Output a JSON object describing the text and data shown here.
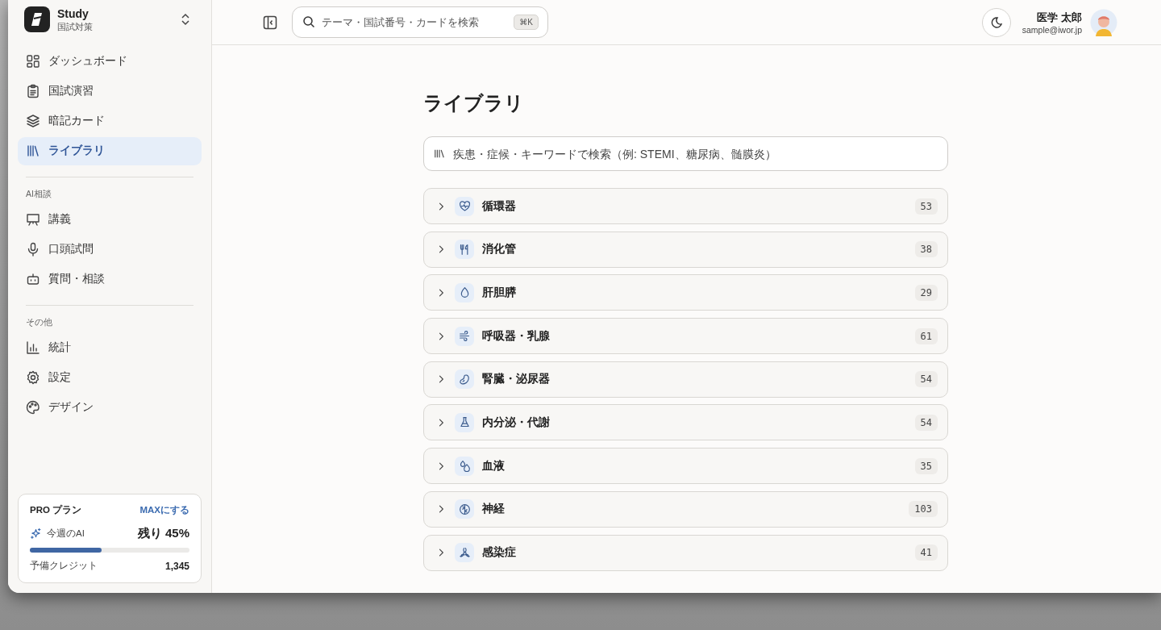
{
  "sidebar": {
    "brand": {
      "name": "Study",
      "subtitle": "国試対策"
    },
    "sections": [
      {
        "items": [
          {
            "label": "ダッシュボード",
            "selected": false
          },
          {
            "label": "国試演習",
            "selected": false
          },
          {
            "label": "暗記カード",
            "selected": false
          },
          {
            "label": "ライブラリ",
            "selected": true
          }
        ]
      },
      {
        "heading": "AI相談",
        "items": [
          {
            "label": "講義",
            "selected": false
          },
          {
            "label": "口頭試問",
            "selected": false
          },
          {
            "label": "質問・相談",
            "selected": false
          }
        ]
      },
      {
        "heading": "その他",
        "items": [
          {
            "label": "統計",
            "selected": false
          },
          {
            "label": "設定",
            "selected": false
          },
          {
            "label": "デザイン",
            "selected": false
          }
        ]
      }
    ],
    "plan": {
      "title": "PRO プラン",
      "upgrade_link": "MAXにする",
      "usage_label": "今週のAI",
      "usage_reading": "残り 45%",
      "level": 0.45,
      "credit_label": "予備クレジット",
      "credit_value": "1,345"
    }
  },
  "header": {
    "search": {
      "placeholder": "テーマ・国試番号・カードを検索",
      "shortcut": "⌘K"
    },
    "user": {
      "name": "医学 太郎",
      "email": "sample@iwor.jp"
    }
  },
  "page": {
    "title": "ライブラリ",
    "search": {
      "placeholder": "疾患・症候・キーワードで検索（例: STEMI、糖尿病、髄膜炎）"
    },
    "categories": [
      {
        "label": "循環器",
        "count": "53"
      },
      {
        "label": "消化管",
        "count": "38"
      },
      {
        "label": "肝胆膵",
        "count": "29"
      },
      {
        "label": "呼吸器・乳腺",
        "count": "61"
      },
      {
        "label": "腎臓・泌尿器",
        "count": "54"
      },
      {
        "label": "内分泌・代謝",
        "count": "54"
      },
      {
        "label": "血液",
        "count": "35"
      },
      {
        "label": "神経",
        "count": "103"
      },
      {
        "label": "感染症",
        "count": "41"
      }
    ]
  }
}
